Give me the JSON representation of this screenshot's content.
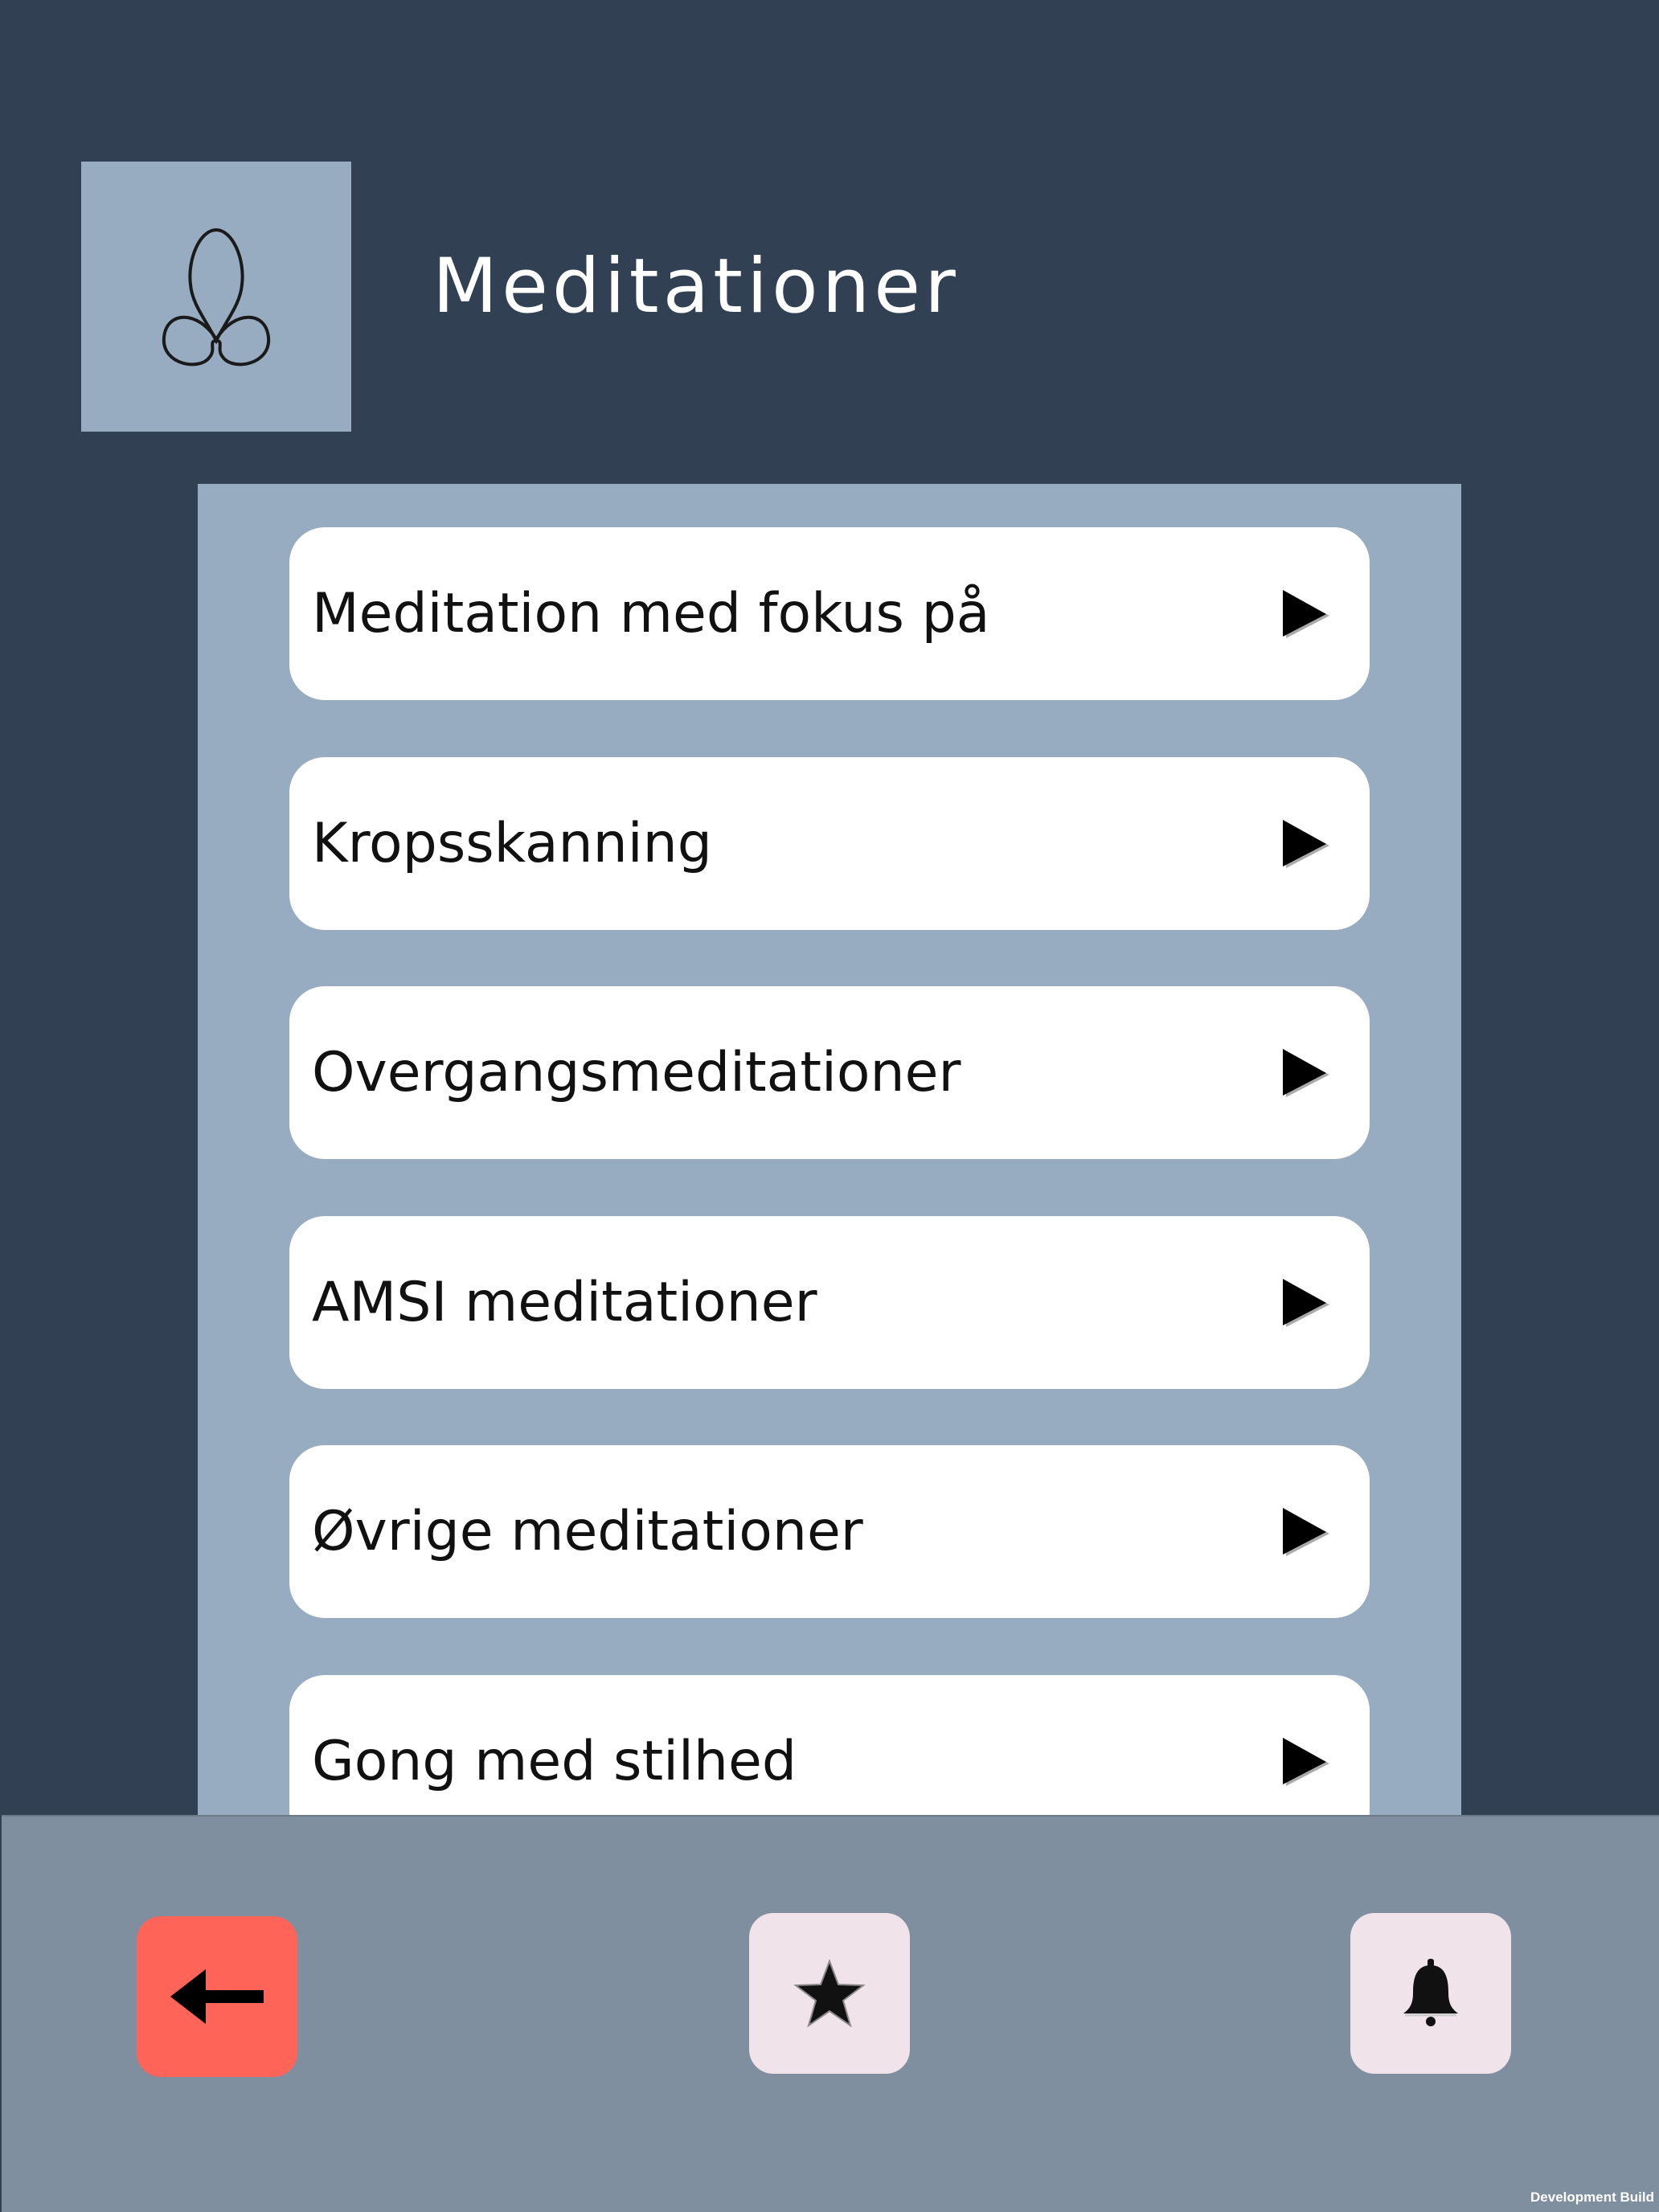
{
  "header": {
    "title": "Meditationer",
    "logo_icon": "meditation-figure-icon"
  },
  "list": {
    "items": [
      {
        "label": "Meditation med fokus på",
        "icon": "play-icon"
      },
      {
        "label": "Kropsskanning",
        "icon": "play-icon"
      },
      {
        "label": "Overgangsmeditationer",
        "icon": "play-icon"
      },
      {
        "label": "AMSI meditationer",
        "icon": "play-icon"
      },
      {
        "label": "Øvrige meditationer",
        "icon": "play-icon"
      },
      {
        "label": "Gong med stilhed",
        "icon": "play-icon"
      }
    ]
  },
  "bottom_nav": {
    "back_icon": "arrow-left-icon",
    "favorites_icon": "star-icon",
    "notifications_icon": "bell-icon"
  },
  "footer": {
    "build_label": "Development Build"
  },
  "colors": {
    "background": "#324053",
    "panel": "#97acc1",
    "bottom_bar": "#7f8fa0",
    "back_button": "#ff6459",
    "nav_button": "#f1e3ea"
  }
}
